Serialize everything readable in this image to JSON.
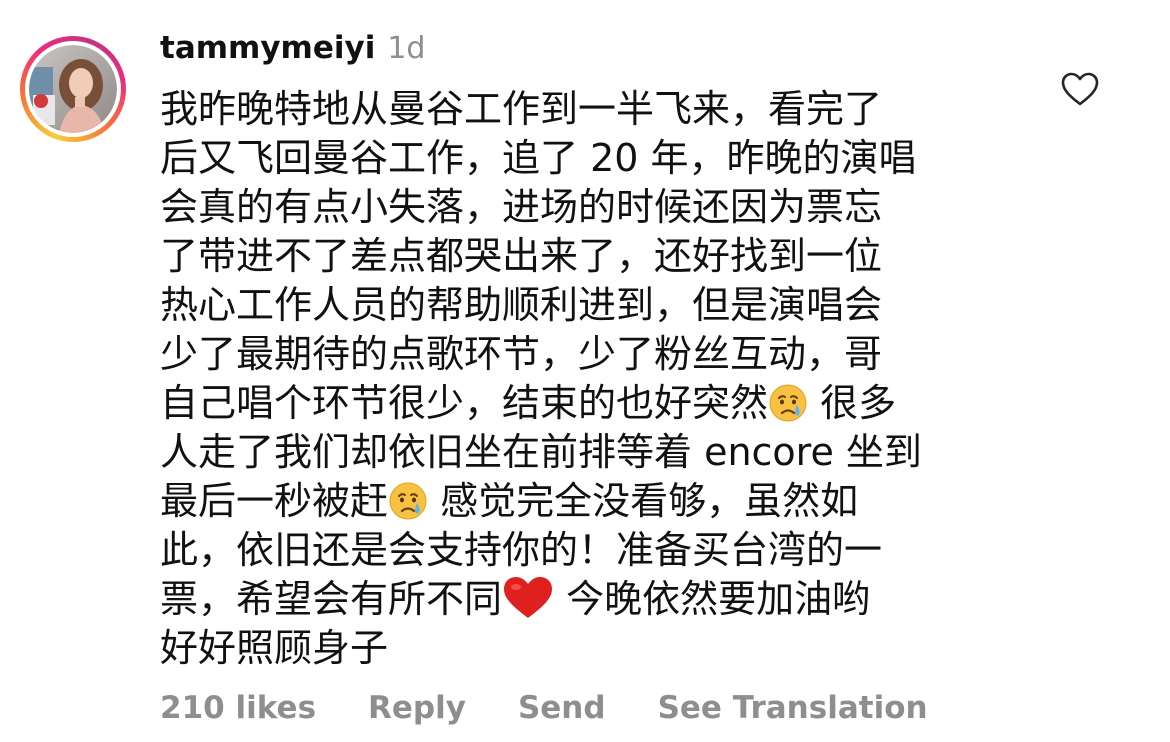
{
  "comment": {
    "username": "tammymeiyi",
    "timestamp": "1d",
    "lines": [
      "我昨晚特地从曼谷工作到一半飞来，看完了",
      "后又飞回曼谷工作，追了 20 年，昨晚的演唱",
      "会真的有点小失落，进场的时候还因为票忘",
      "了带进不了差点都哭出来了，还好找到一位",
      "热心工作人员的帮助顺利进到，但是演唱会",
      "少了最期待的点歌环节，少了粉丝互动，哥"
    ],
    "line7": {
      "before": "自己唱个环节很少，结束的也好突然",
      "after": " 很多"
    },
    "line8": "人走了我们却依旧坐在前排等着 encore 坐到",
    "line9": {
      "before": "最后一秒被赶",
      "after": "  感觉完全没看够，虽然如"
    },
    "line10": "此，依旧还是会支持你的！准备买台湾的一",
    "line11": {
      "before": "票，希望会有所不同",
      "after": " 今晚依然要加油哟"
    },
    "line12": "好好照顾身子",
    "emojis": {
      "crying": "crying-face",
      "heart": "red-heart"
    }
  },
  "actions": {
    "likes": "210 likes",
    "reply": "Reply",
    "send": "Send",
    "translate": "See Translation"
  },
  "colors": {
    "text": "#111111",
    "muted": "#8e8e8e",
    "ring_start": "#f9ce34",
    "ring_mid": "#ee2a7b",
    "ring_end": "#c13584",
    "heart_emoji": "#e0201f"
  }
}
